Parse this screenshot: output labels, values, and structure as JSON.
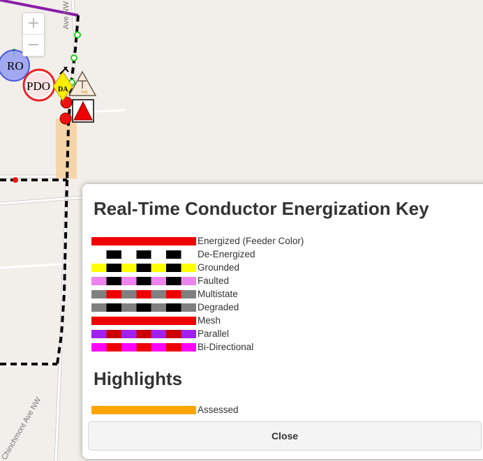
{
  "map": {
    "zoom_in": "+",
    "zoom_out": "−",
    "street_top": "Ave NW",
    "street_bottom": "Chinchmont Ave NW",
    "symbols": {
      "ro": "RO",
      "pdo": "PDO",
      "da": "DA",
      "wb": "WB"
    }
  },
  "legend": {
    "title": "Real-Time Conductor Energization Key",
    "items": [
      {
        "label": "Energized (Feeder Color)",
        "pattern": [
          "#ee0000"
        ]
      },
      {
        "label": "De-Energized",
        "pattern": [
          "#ffffff",
          "#000000"
        ]
      },
      {
        "label": "Grounded",
        "pattern": [
          "#ffff00",
          "#000000"
        ]
      },
      {
        "label": "Faulted",
        "pattern": [
          "#ee82ee",
          "#000000"
        ]
      },
      {
        "label": "Multistate",
        "pattern": [
          "#808080",
          "#ee0000"
        ]
      },
      {
        "label": "Degraded",
        "pattern": [
          "#808080",
          "#000000"
        ]
      },
      {
        "label": "Mesh",
        "pattern": [
          "#ee0000"
        ]
      },
      {
        "label": "Parallel",
        "pattern": [
          "#a020f0",
          "#cc0000"
        ]
      },
      {
        "label": "Bi-Directional",
        "pattern": [
          "#ff00ff",
          "#ee0000"
        ]
      }
    ],
    "highlights_title": "Highlights",
    "highlights": [
      {
        "label": "Assessed",
        "pattern": [
          "#ffa500"
        ]
      }
    ],
    "close_label": "Close"
  },
  "colors": {
    "feeder_purple": "#8b1fa9",
    "energized_red": "#ee0000",
    "deenergized_black": "#000000",
    "highlight_orange": "#ffa500"
  }
}
